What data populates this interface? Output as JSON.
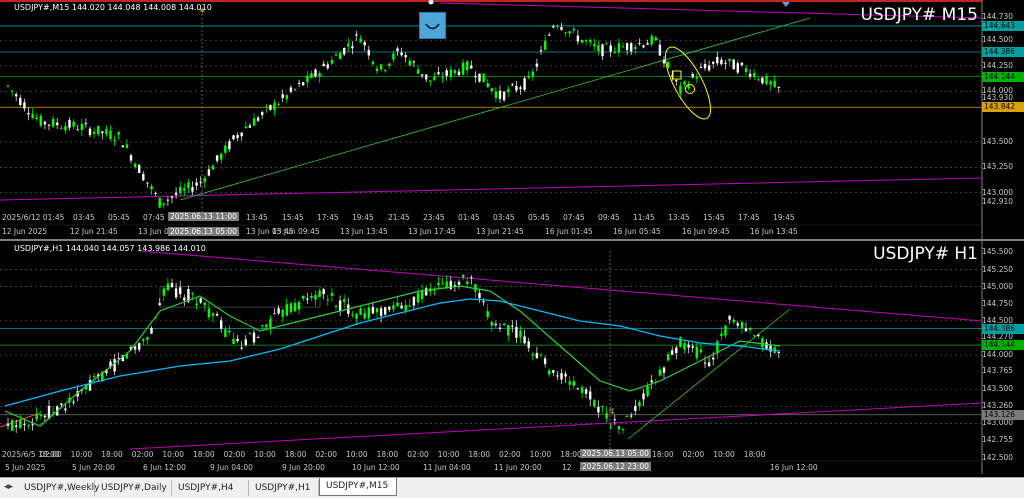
{
  "colors": {
    "bg": "#000000",
    "bull": "#00ff00",
    "bear": "#ffffff",
    "ma_green": "#32cd32",
    "ma_cyan": "#00bfff",
    "trend_magenta": "#c000c0",
    "hline_cyan": "#00a0a0",
    "hline_green": "#00b000",
    "hline_gold": "#d8a000",
    "annot": "#ffff00"
  },
  "top": {
    "info": "USDJPY#,M15  144.020 144.048 144.008 144.010",
    "symbol": "USDJPY#  M15",
    "prices": [
      "144.730",
      "144.500",
      "144.250",
      "144.000",
      "143.930",
      "143.500",
      "143.250",
      "143.000",
      "142.910"
    ],
    "tags": [
      {
        "text": "144.643",
        "color": "#00a0a0"
      },
      {
        "text": "144.386",
        "color": "#00a0a0"
      },
      {
        "text": "144.144",
        "color": "#00b000"
      },
      {
        "text": "143.842",
        "color": "#d8a000"
      }
    ],
    "times": [
      "2025/6/12 01:45",
      "03:45",
      "05:45",
      "07:45",
      "13:45",
      "15:45",
      "17:45",
      "19:45",
      "21:45",
      "23:45",
      "01:45",
      "03:45",
      "05:45",
      "07:45",
      "09:45",
      "11:45",
      "13:45",
      "15:45",
      "17:45",
      "19:45"
    ],
    "dates": [
      "12 Jun 2025",
      "12 Jun 21:45",
      "13 Jun 01:45",
      "13 Jun 05:45",
      "13 Jun 09:45",
      "13 Jun 13:45",
      "13 Jun 17:45",
      "13 Jun 21:45",
      "16 Jun 01:45",
      "16 Jun 05:45",
      "16 Jun 09:45",
      "16 Jun 13:45"
    ],
    "crosshair_time": "2025.06.13 11:00",
    "crosshair_date": "2025.06.13 05:00"
  },
  "bottom": {
    "info": "USDJPY#,H1  144.040 144.057 143.986 144.010",
    "symbol": "USDJPY#  H1",
    "prices": [
      "145.500",
      "145.250",
      "145.000",
      "144.750",
      "144.500",
      "144.270",
      "144.000",
      "143.765",
      "143.500",
      "143.260",
      "143.000",
      "142.755",
      "142.500"
    ],
    "tags": [
      {
        "text": "144.386",
        "color": "#00a0a0"
      },
      {
        "text": "144.144",
        "color": "#00b000"
      },
      {
        "text": "143.126",
        "color": "#7a7a7a"
      }
    ],
    "times": [
      "2025/6/5 18:00",
      "5 Jun 2025",
      "5 Jun 20:00",
      "6 Jun 12:00",
      "9 Jun 04:00",
      "9 Jun 20:00",
      "10 Jun 12:00",
      "11 Jun 04:00",
      "11 Jun 20:00",
      "12",
      "16 Jun 12:00"
    ],
    "hours": [
      "02:00",
      "10:00",
      "18:00",
      "02:00",
      "10:00",
      "18:00",
      "02:00",
      "10:00",
      "18:00",
      "02:00",
      "10:00",
      "18:00",
      "02:00",
      "10:00",
      "18:00",
      "02:00",
      "10:00",
      "18:00",
      "02:00",
      "10:00",
      "18:00",
      "02:00",
      "10:00",
      "18:00"
    ],
    "crosshair_time": "2025.06.13 05:00",
    "crosshair_date": "2025.06.12 23:00"
  },
  "tabs": [
    "USDJPY#,Weekly",
    "USDJPY#,Daily",
    "USDJPY#,H4",
    "USDJPY#,H1",
    "USDJPY#,M15"
  ],
  "active_tab": "USDJPY#,M15"
}
